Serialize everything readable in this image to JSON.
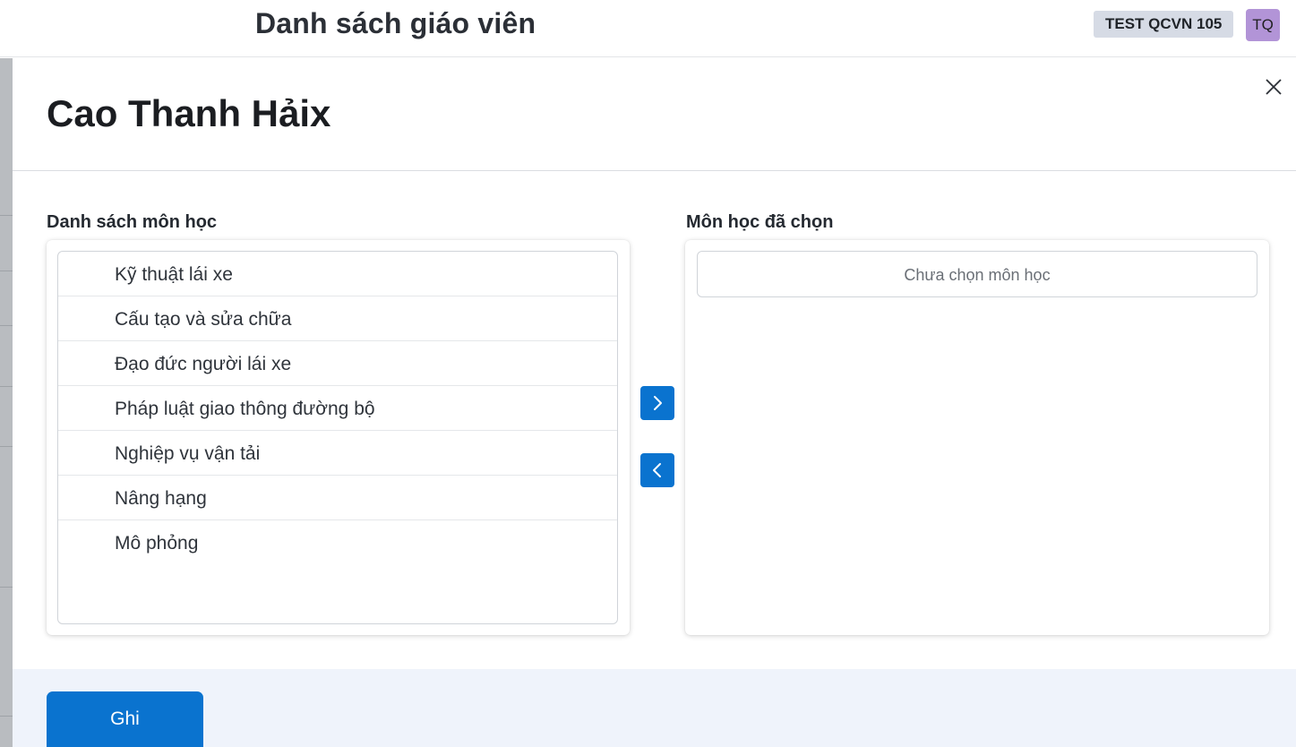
{
  "topbar": {
    "title": "Danh sách giáo viên",
    "org_badge": "TEST QCVN 105",
    "avatar_initials": "TQ"
  },
  "panel": {
    "title": "Cao Thanh Hảix",
    "close_icon": "close-icon"
  },
  "subjects": {
    "label": "Danh sách môn học",
    "items": [
      "Kỹ thuật lái xe",
      "Cấu tạo và sửa chữa",
      "Đạo đức người lái xe",
      "Pháp luật giao thông đường bộ",
      "Nghiệp vụ vận tải",
      "Nâng hạng",
      "Mô phỏng"
    ]
  },
  "selected": {
    "label": "Môn học đã chọn",
    "empty_text": "Chưa chọn môn học"
  },
  "controls": {
    "move_right_icon": "chevron-right-icon",
    "move_left_icon": "chevron-left-icon"
  },
  "footer": {
    "save_label": "Ghi"
  },
  "colors": {
    "accent": "#0a73cf",
    "avatar_bg": "#b294d7",
    "badge_bg": "#d6dbe5",
    "footer_bg": "#eff3fb"
  }
}
